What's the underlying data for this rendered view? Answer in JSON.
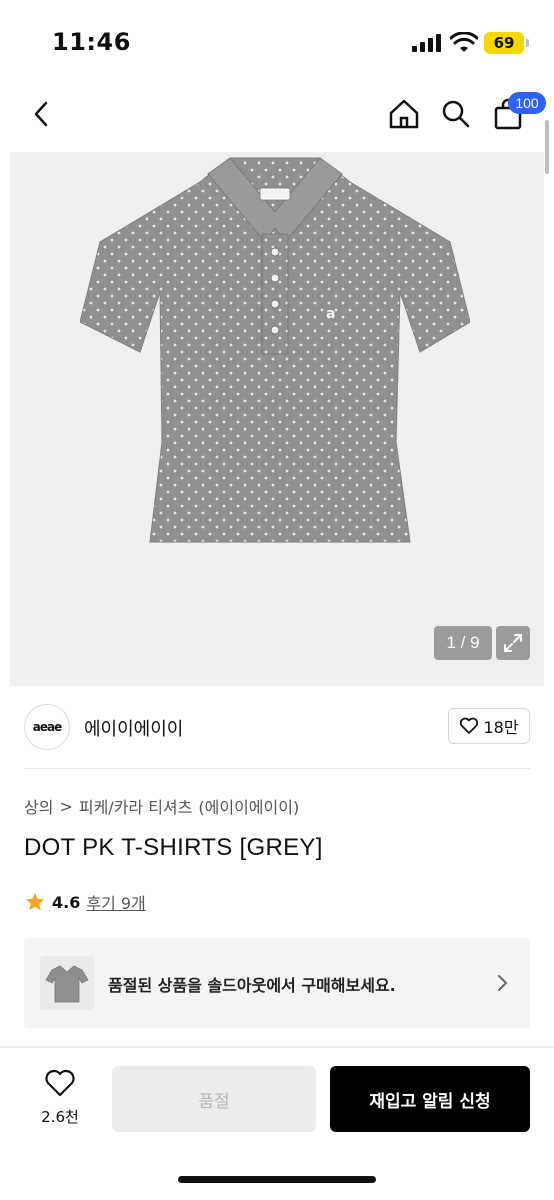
{
  "status_bar": {
    "time": "11:46",
    "battery": "69"
  },
  "nav": {
    "cart_count": "100"
  },
  "gallery": {
    "counter": "1 / 9"
  },
  "brand": {
    "logo_text": "aeae",
    "name": "에이이에이이",
    "likes": "18만"
  },
  "breadcrumb": {
    "items": [
      "상의",
      "피케/카라 티셔츠",
      "(에이이에이이)"
    ],
    "separator": ">"
  },
  "product": {
    "title": "DOT PK T-SHIRTS [GREY]",
    "rating": "4.6",
    "reviews": "후기 9개"
  },
  "resell": {
    "text": "품절된 상품을 솔드아웃에서 구매해보세요."
  },
  "bottom_bar": {
    "favorite_count": "2.6천",
    "soldout_label": "품절",
    "restock_label": "재입고 알림 신청"
  },
  "colors": {
    "accent_badge": "#2e63f2",
    "battery": "#f5d800",
    "star": "#f5a623"
  }
}
